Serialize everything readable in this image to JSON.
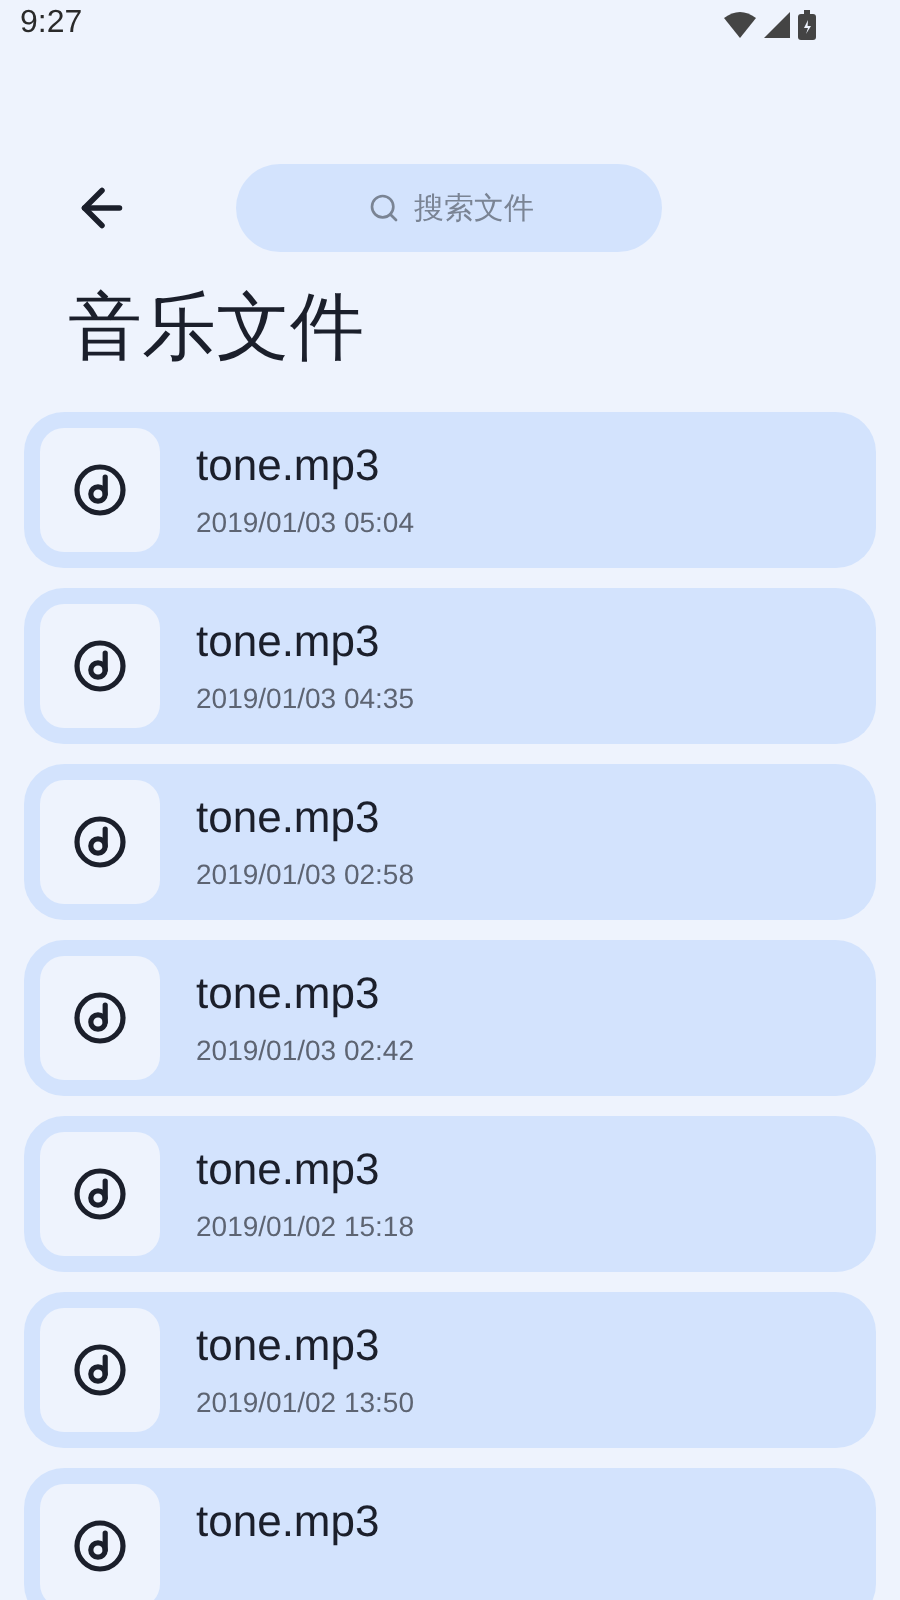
{
  "status_bar": {
    "time": "9:27"
  },
  "search": {
    "placeholder": "搜索文件"
  },
  "title": "音乐文件",
  "files": [
    {
      "name": "tone.mp3",
      "date": "2019/01/03 05:04"
    },
    {
      "name": "tone.mp3",
      "date": "2019/01/03 04:35"
    },
    {
      "name": "tone.mp3",
      "date": "2019/01/03 02:58"
    },
    {
      "name": "tone.mp3",
      "date": "2019/01/03 02:42"
    },
    {
      "name": "tone.mp3",
      "date": "2019/01/02 15:18"
    },
    {
      "name": "tone.mp3",
      "date": "2019/01/02 13:50"
    },
    {
      "name": "tone.mp3"
    }
  ]
}
